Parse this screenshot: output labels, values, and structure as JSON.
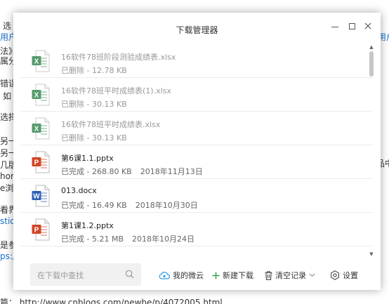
{
  "background": {
    "fragments": [
      "选",
      "用户i",
      "法》",
      "属分",
      "错误",
      "如",
      "选择",
      "另一",
      "另一",
      "几版",
      "hon",
      "e浏",
      "看界",
      "stio",
      "ps:/",
      "是参",
      "品中",
      "用户工"
    ],
    "lines": [
      "篇：  http://www.cnblogs.com/newbe/p/4072005.html"
    ]
  },
  "dialog": {
    "title": "下载管理器",
    "items": [
      {
        "name": "16软件78班阶段测验成绩表.xlsx",
        "status": "已删除",
        "size": "12.78 KB",
        "date": "",
        "type": "xlsx",
        "deleted": true
      },
      {
        "name": "16软件78班平时成绩表(1).xlsx",
        "status": "已删除",
        "size": "30.13 KB",
        "date": "",
        "type": "xlsx",
        "deleted": true
      },
      {
        "name": "16软件78班平时成绩表.xlsx",
        "status": "已删除",
        "size": "30.13 KB",
        "date": "",
        "type": "xlsx",
        "deleted": true
      },
      {
        "name": "第6课1.1.pptx",
        "status": "已完成",
        "size": "268.80 KB",
        "date": "2018年11月13日",
        "type": "pptx",
        "deleted": false
      },
      {
        "name": "013.docx",
        "status": "已完成",
        "size": "16.49 KB",
        "date": "2018年10月30日",
        "type": "docx",
        "deleted": false
      },
      {
        "name": "第1课1.2.pptx",
        "status": "已完成",
        "size": "5.21 MB",
        "date": "2018年10月24日",
        "type": "pptx",
        "deleted": false
      }
    ],
    "footer": {
      "search_placeholder": "在下载中查找",
      "cloud_label": "我的微云",
      "new_label": "新建下载",
      "clear_label": "清空记录",
      "settings_label": "设置"
    },
    "colors": {
      "xlsx": "#1d7a3d",
      "pptx": "#d04526",
      "docx": "#2b5fb4",
      "cloud": "#2f9ee6",
      "plus": "#2ea34a"
    }
  }
}
